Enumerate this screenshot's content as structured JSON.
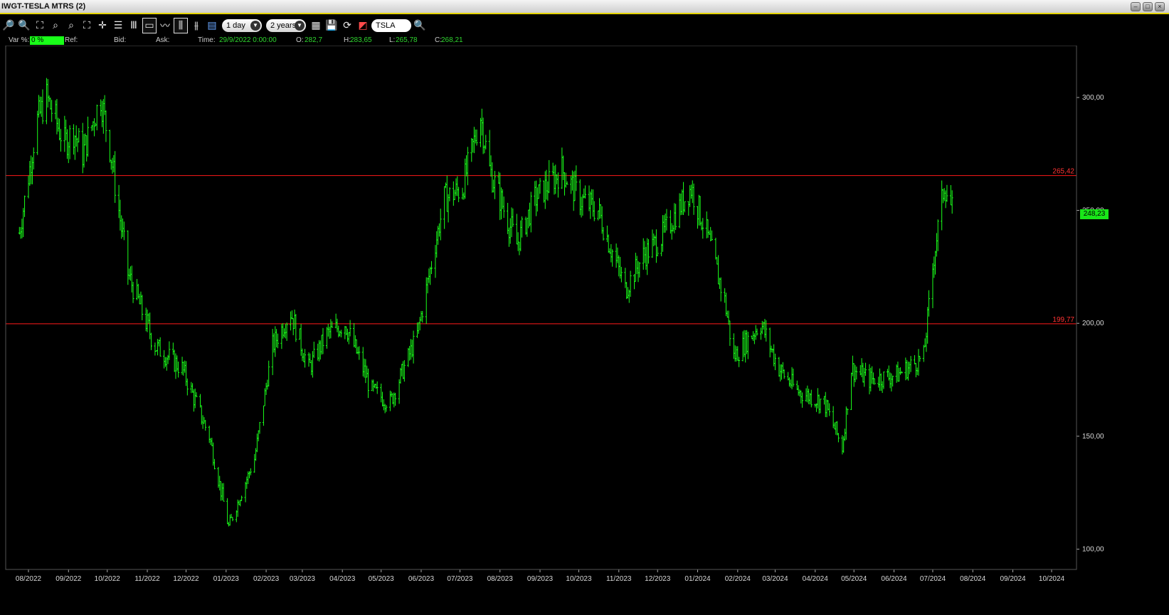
{
  "window": {
    "title": "IWGT-TESLA MTRS (2)",
    "controls": [
      "minimize",
      "restore",
      "close"
    ]
  },
  "toolbar": {
    "tools": [
      {
        "name": "zoom-in-icon",
        "glyph": "🔎"
      },
      {
        "name": "zoom-out-icon",
        "glyph": "🔍"
      },
      {
        "name": "zoom-fit-icon",
        "glyph": "⛶"
      },
      {
        "name": "zoom-x-icon",
        "glyph": "⌕"
      },
      {
        "name": "zoom-y-icon",
        "glyph": "⌕"
      },
      {
        "name": "zoom-reset-icon",
        "glyph": "⛶"
      },
      {
        "name": "crosshair-icon",
        "glyph": "✛"
      },
      {
        "name": "list-icon",
        "glyph": "☰"
      },
      {
        "name": "bars-icon",
        "glyph": "Ⅲ"
      },
      {
        "name": "window-icon",
        "glyph": "▭"
      },
      {
        "name": "line-chart-icon",
        "glyph": "〰"
      },
      {
        "name": "candlestick-icon",
        "glyph": "⫼"
      },
      {
        "name": "ohlc-icon",
        "glyph": "⫵"
      },
      {
        "name": "indicators-icon",
        "glyph": "▤"
      }
    ],
    "interval": "1 day",
    "range": "2 years",
    "tools2": [
      {
        "name": "print-icon",
        "glyph": "▦"
      },
      {
        "name": "save-icon",
        "glyph": "💾"
      },
      {
        "name": "refresh-icon",
        "glyph": "⟳"
      },
      {
        "name": "alert-icon",
        "glyph": "◩"
      }
    ],
    "symbol": "TSLA",
    "search_icon": "🔍"
  },
  "infobar": {
    "var_label": "Var %:",
    "var_value": "0 %",
    "ref_label": "Ref:",
    "bid_label": "Bid:",
    "ask_label": "Ask:",
    "time_label": "Time:",
    "time_value": "29/9/2022 0:00:00",
    "o_label": "O:",
    "o_value": "282,7",
    "h_label": "H:",
    "h_value": "283,65",
    "l_label": "L:",
    "l_value": "265,78",
    "c_label": "C:",
    "c_value": "268,21"
  },
  "chart_data": {
    "type": "bar",
    "instrument": "TSLA",
    "interval": "1 day",
    "y_ticks": [
      "100,00",
      "150,00",
      "200,00",
      "250,00",
      "300,00"
    ],
    "y_tick_values": [
      100,
      150,
      200,
      250,
      300
    ],
    "ylim": [
      91,
      323
    ],
    "x_ticks": [
      "08/2022",
      "09/2022",
      "10/2022",
      "11/2022",
      "12/2022",
      "01/2023",
      "02/2023",
      "03/2023",
      "04/2023",
      "05/2023",
      "06/2023",
      "07/2023",
      "08/2023",
      "09/2023",
      "10/2023",
      "11/2023",
      "12/2023",
      "01/2024",
      "02/2024",
      "03/2024",
      "04/2024",
      "05/2024",
      "06/2024",
      "07/2024",
      "08/2024",
      "09/2024",
      "10/2024"
    ],
    "horizontal_lines": [
      {
        "value": 265.42,
        "label": "265,42",
        "color": "#ff1a1a"
      },
      {
        "value": 199.77,
        "label": "199,77",
        "color": "#ff1a1a"
      }
    ],
    "last_price": "248,23",
    "series_color": "#1aff1a",
    "series": {
      "values": [
        {
          "date": "2022-07-25",
          "close": 240
        },
        {
          "date": "2022-08-08",
          "close": 290
        },
        {
          "date": "2022-08-15",
          "close": 300
        },
        {
          "date": "2022-08-29",
          "close": 280
        },
        {
          "date": "2022-09-05",
          "close": 285
        },
        {
          "date": "2022-09-12",
          "close": 275
        },
        {
          "date": "2022-09-26",
          "close": 300
        },
        {
          "date": "2022-10-03",
          "close": 278
        },
        {
          "date": "2022-10-17",
          "close": 222
        },
        {
          "date": "2022-11-07",
          "close": 190
        },
        {
          "date": "2022-11-28",
          "close": 180
        },
        {
          "date": "2022-12-19",
          "close": 150
        },
        {
          "date": "2023-01-03",
          "close": 110
        },
        {
          "date": "2023-01-23",
          "close": 140
        },
        {
          "date": "2023-02-06",
          "close": 190
        },
        {
          "date": "2023-02-20",
          "close": 205
        },
        {
          "date": "2023-03-06",
          "close": 180
        },
        {
          "date": "2023-03-20",
          "close": 195
        },
        {
          "date": "2023-04-03",
          "close": 200
        },
        {
          "date": "2023-04-24",
          "close": 170
        },
        {
          "date": "2023-05-08",
          "close": 165
        },
        {
          "date": "2023-05-29",
          "close": 195
        },
        {
          "date": "2023-06-19",
          "close": 255
        },
        {
          "date": "2023-07-03",
          "close": 260
        },
        {
          "date": "2023-07-17",
          "close": 292
        },
        {
          "date": "2023-07-24",
          "close": 268
        },
        {
          "date": "2023-08-14",
          "close": 235
        },
        {
          "date": "2023-08-28",
          "close": 255
        },
        {
          "date": "2023-09-18",
          "close": 268
        },
        {
          "date": "2023-10-02",
          "close": 255
        },
        {
          "date": "2023-10-16",
          "close": 250
        },
        {
          "date": "2023-11-06",
          "close": 215
        },
        {
          "date": "2023-11-20",
          "close": 230
        },
        {
          "date": "2023-12-04",
          "close": 238
        },
        {
          "date": "2023-12-27",
          "close": 260
        },
        {
          "date": "2024-01-08",
          "close": 240
        },
        {
          "date": "2024-01-22",
          "close": 210
        },
        {
          "date": "2024-01-29",
          "close": 185
        },
        {
          "date": "2024-02-19",
          "close": 200
        },
        {
          "date": "2024-03-04",
          "close": 180
        },
        {
          "date": "2024-03-18",
          "close": 170
        },
        {
          "date": "2024-04-08",
          "close": 165
        },
        {
          "date": "2024-04-22",
          "close": 145
        },
        {
          "date": "2024-04-29",
          "close": 180
        },
        {
          "date": "2024-05-13",
          "close": 175
        },
        {
          "date": "2024-06-03",
          "close": 177
        },
        {
          "date": "2024-06-24",
          "close": 185
        },
        {
          "date": "2024-07-02",
          "close": 230
        },
        {
          "date": "2024-07-10",
          "close": 262
        },
        {
          "date": "2024-07-17",
          "close": 248
        }
      ]
    }
  }
}
